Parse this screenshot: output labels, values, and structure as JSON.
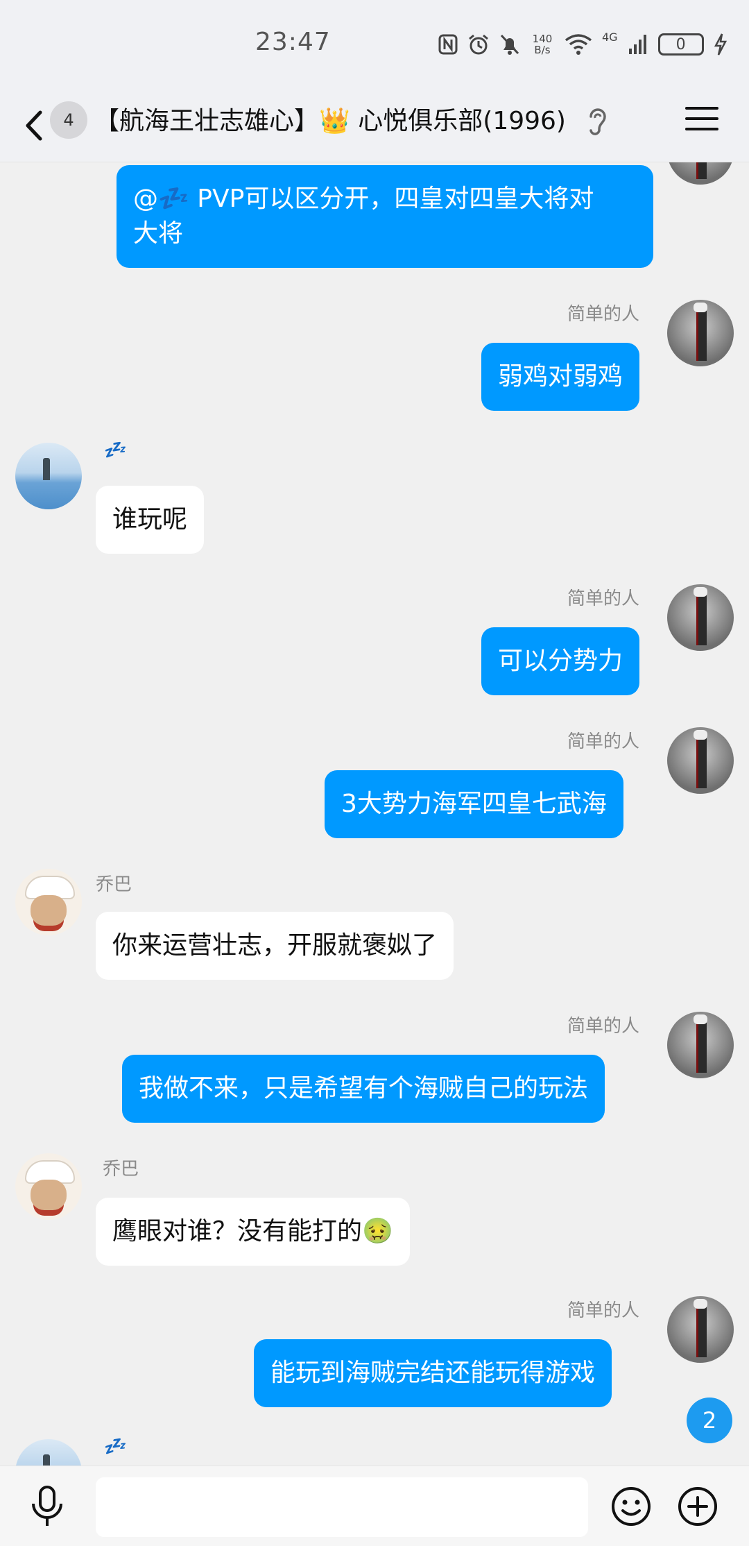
{
  "status_bar": {
    "time": "23:47",
    "net_speed_value": "140",
    "net_speed_unit": "B/s",
    "network_type": "4G",
    "battery": "0",
    "icons": [
      "nfc-icon",
      "alarm-icon",
      "mute-icon",
      "wifi-icon",
      "signal-icon",
      "battery-icon",
      "charging-icon"
    ]
  },
  "header": {
    "unread_count": "4",
    "title": "【航海王壮志雄心】👑 心悦俱乐部(1996)"
  },
  "messages": [
    {
      "side": "out",
      "sender": "",
      "text_line1": "@💤 PVP可以区分开，四皇对四皇大将对",
      "text_line2": "大将"
    },
    {
      "side": "out",
      "sender": "简单的人",
      "text": "弱鸡对弱鸡"
    },
    {
      "side": "in",
      "sender": "💤",
      "text": "谁玩呢"
    },
    {
      "side": "out",
      "sender": "简单的人",
      "text": "可以分势力"
    },
    {
      "side": "out",
      "sender": "简单的人",
      "text": "3大势力海军四皇七武海"
    },
    {
      "side": "in",
      "sender": "乔巴",
      "text": "你来运营壮志，开服就褒姒了"
    },
    {
      "side": "out",
      "sender": "简单的人",
      "text": "我做不来，只是希望有个海贼自己的玩法"
    },
    {
      "side": "in",
      "sender": "乔巴",
      "text": "鹰眼对谁？没有能打的🤢"
    },
    {
      "side": "out",
      "sender": "简单的人",
      "text": "能玩到海贼完结还能玩得游戏"
    },
    {
      "side": "in",
      "sender": "💤",
      "text": ""
    }
  ],
  "new_message_badge": "2",
  "input": {
    "placeholder": "",
    "value": ""
  },
  "colors": {
    "outgoing_bubble": "#0099ff",
    "incoming_bubble": "#ffffff",
    "background": "#f0f0f0",
    "badge": "#1d9bf0"
  }
}
